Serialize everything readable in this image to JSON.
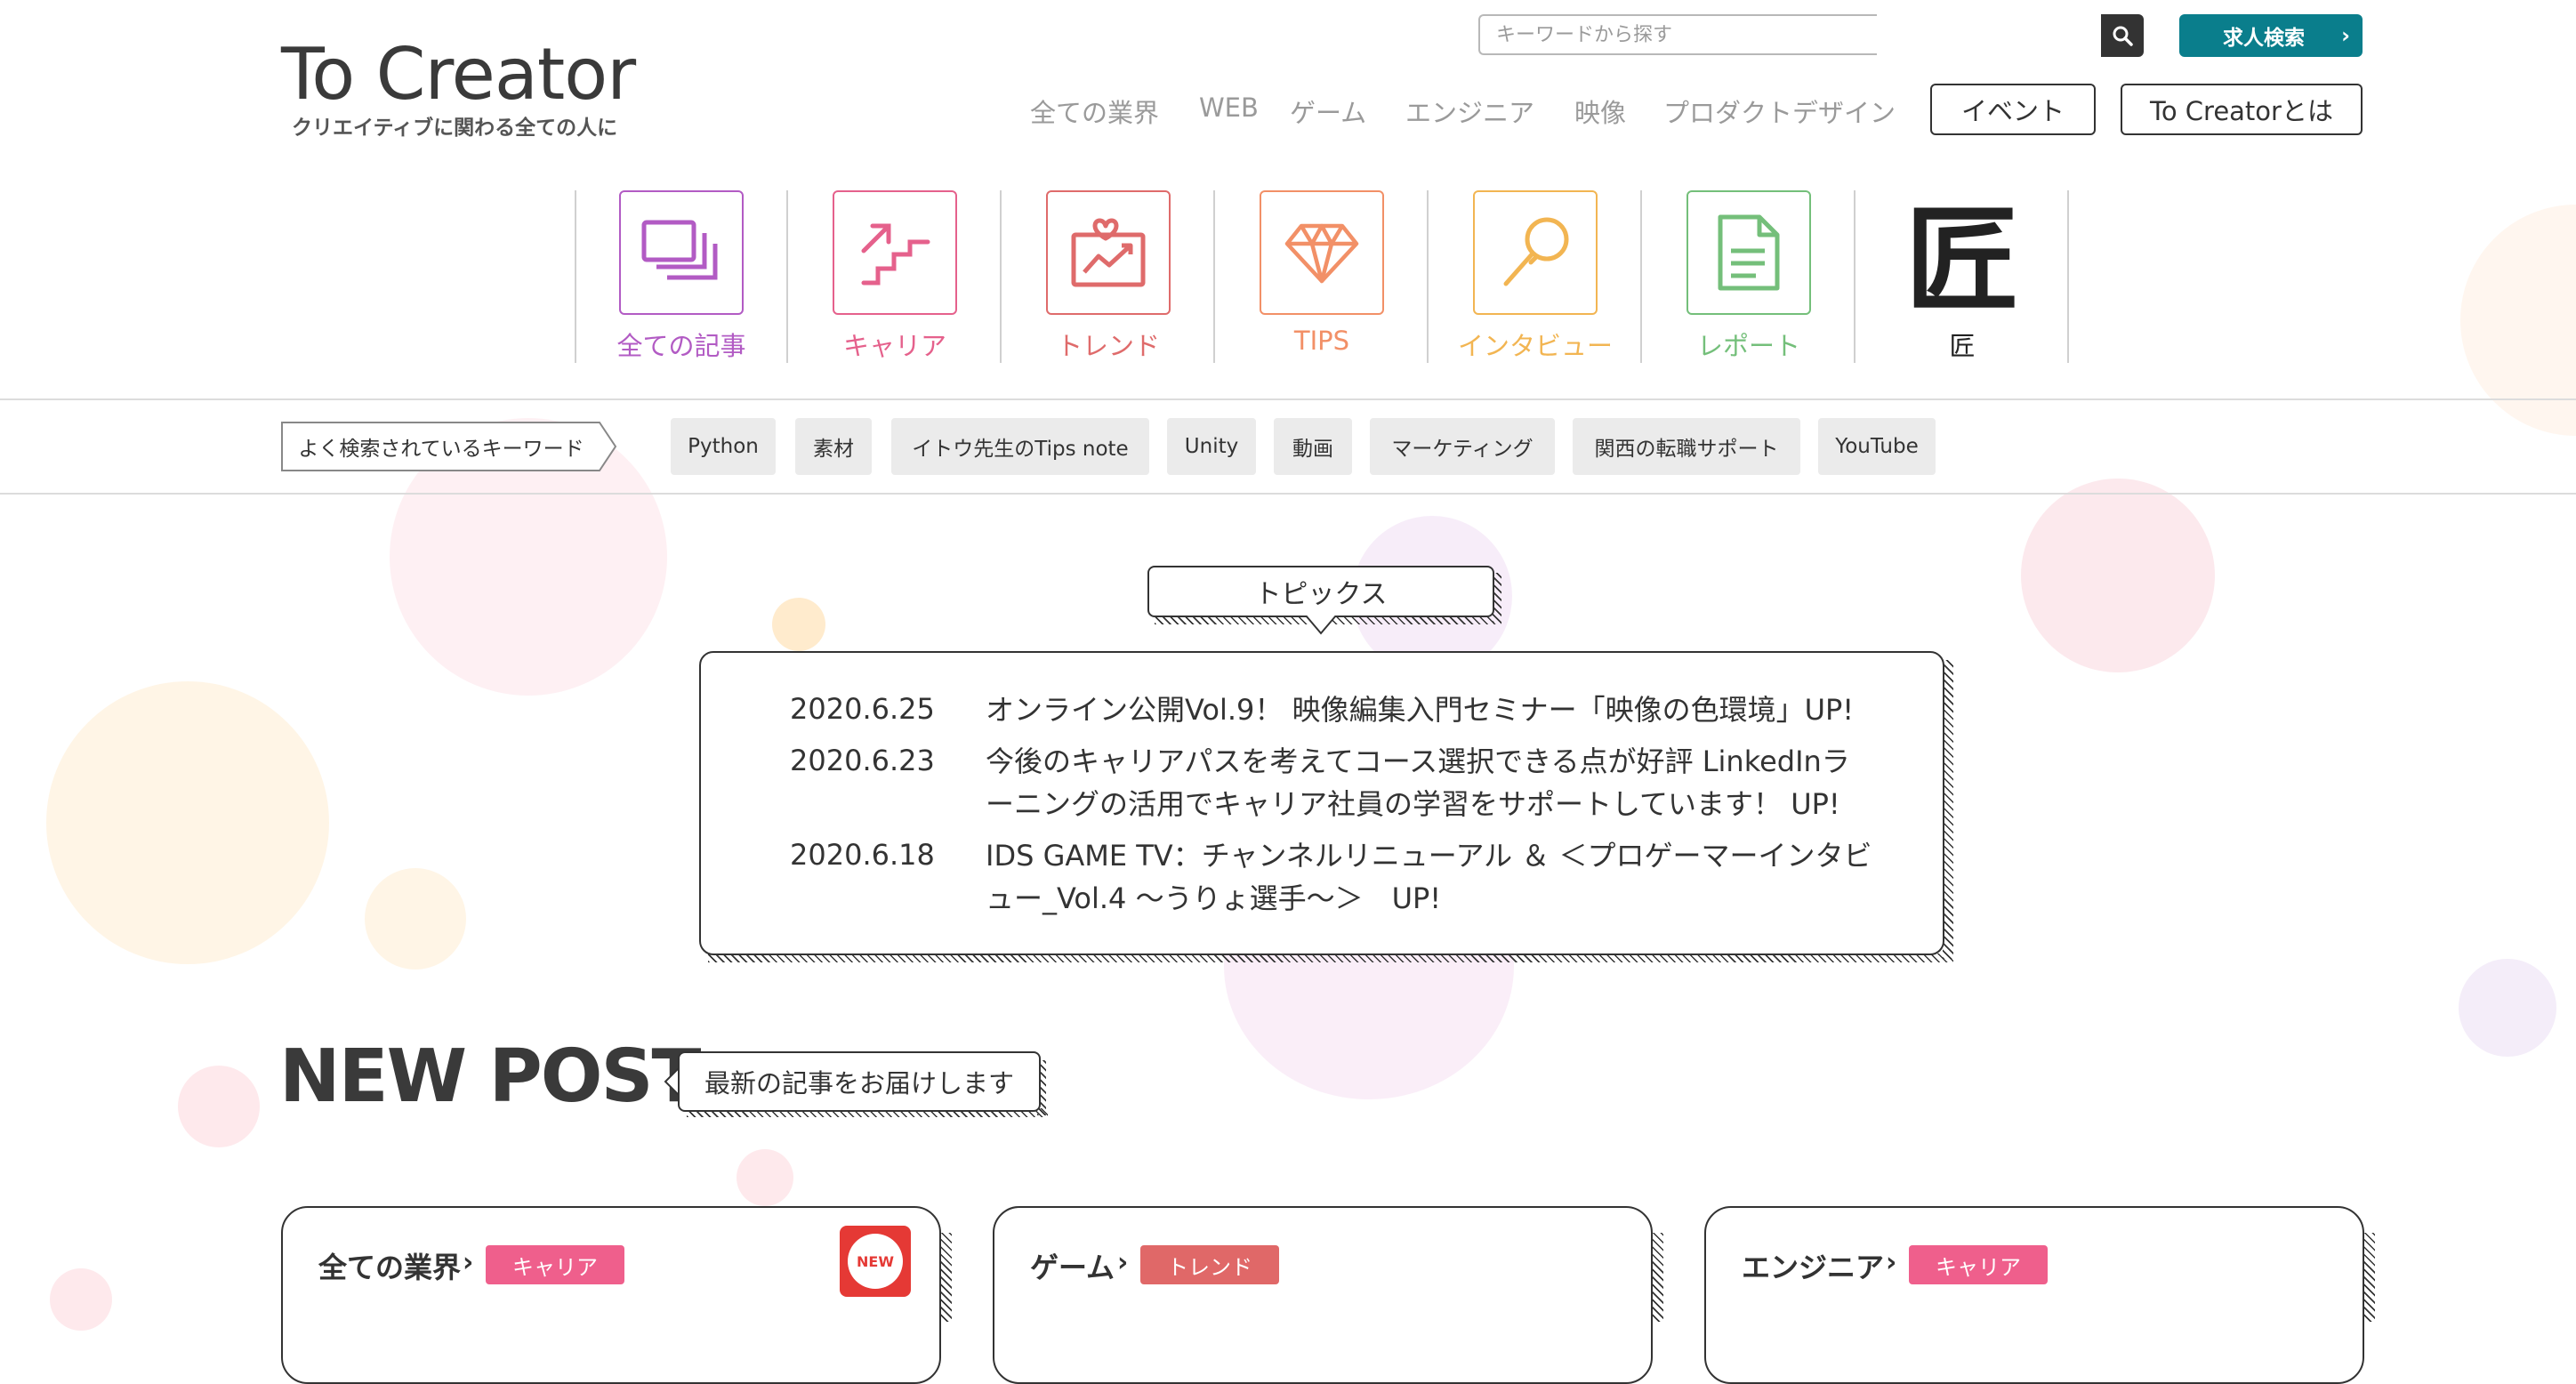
{
  "brand": {
    "logo_title": "To Creator",
    "logo_subtitle": "クリエイティブに関わる全ての人に"
  },
  "search": {
    "placeholder": "キーワードから探す",
    "value": ""
  },
  "job_search": {
    "label": "求人検索",
    "chevron": "›"
  },
  "nav": {
    "links": [
      "全ての業界",
      "WEB",
      "ゲーム",
      "エンジニア",
      "映像",
      "プロダクトデザイン"
    ],
    "event_label": "イベント",
    "about_label": "To Creatorとは"
  },
  "categories": [
    {
      "label": "全ての記事",
      "icon": "stacked-pages-icon",
      "color": "#b25bc4"
    },
    {
      "label": "キャリア",
      "icon": "stairs-up-icon",
      "color": "#e5618c"
    },
    {
      "label": "トレンド",
      "icon": "trend-chart-icon",
      "color": "#df6b6b"
    },
    {
      "label": "TIPS",
      "icon": "diamond-icon",
      "color": "#f29067"
    },
    {
      "label": "インタビュー",
      "icon": "microphone-icon",
      "color": "#f2b552"
    },
    {
      "label": "レポート",
      "icon": "document-icon",
      "color": "#74bf7a"
    },
    {
      "label": "匠",
      "icon": "takumi-kanji-icon",
      "color": "#222222",
      "glyph": "匠"
    }
  ],
  "keywords": {
    "label": "よく検索されているキーワード",
    "tags": [
      "Python",
      "素材",
      "イトウ先生のTips note",
      "Unity",
      "動画",
      "マーケティング",
      "関西の転職サポート",
      "YouTube"
    ]
  },
  "topics": {
    "title": "トピックス",
    "items": [
      {
        "date": "2020.6.25",
        "text": "オンライン公開Vol.9！ 映像編集入門セミナー「映像の色環境」UP!"
      },
      {
        "date": "2020.6.23",
        "text": "今後のキャリアパスを考えてコース選択できる点が好評 LinkedInラーニングの活用でキャリア社員の学習をサポートしています！ UP!"
      },
      {
        "date": "2020.6.18",
        "text": "IDS GAME TV：チャンネルリニューアル ＆ ＜プロゲーマーインタビュー_Vol.4 〜うりょ選手〜＞　UP!"
      }
    ]
  },
  "new_post": {
    "title": "NEW POST",
    "subtitle": "最新の記事をお届けします",
    "cards": [
      {
        "category": "全ての業界",
        "tag": "キャリア",
        "tag_color": "#ef5f8c",
        "new_badge": "NEW"
      },
      {
        "category": "ゲーム",
        "tag": "トレンド",
        "tag_color": "#e06868"
      },
      {
        "category": "エンジニア",
        "tag": "キャリア",
        "tag_color": "#ef5f8c"
      }
    ]
  }
}
